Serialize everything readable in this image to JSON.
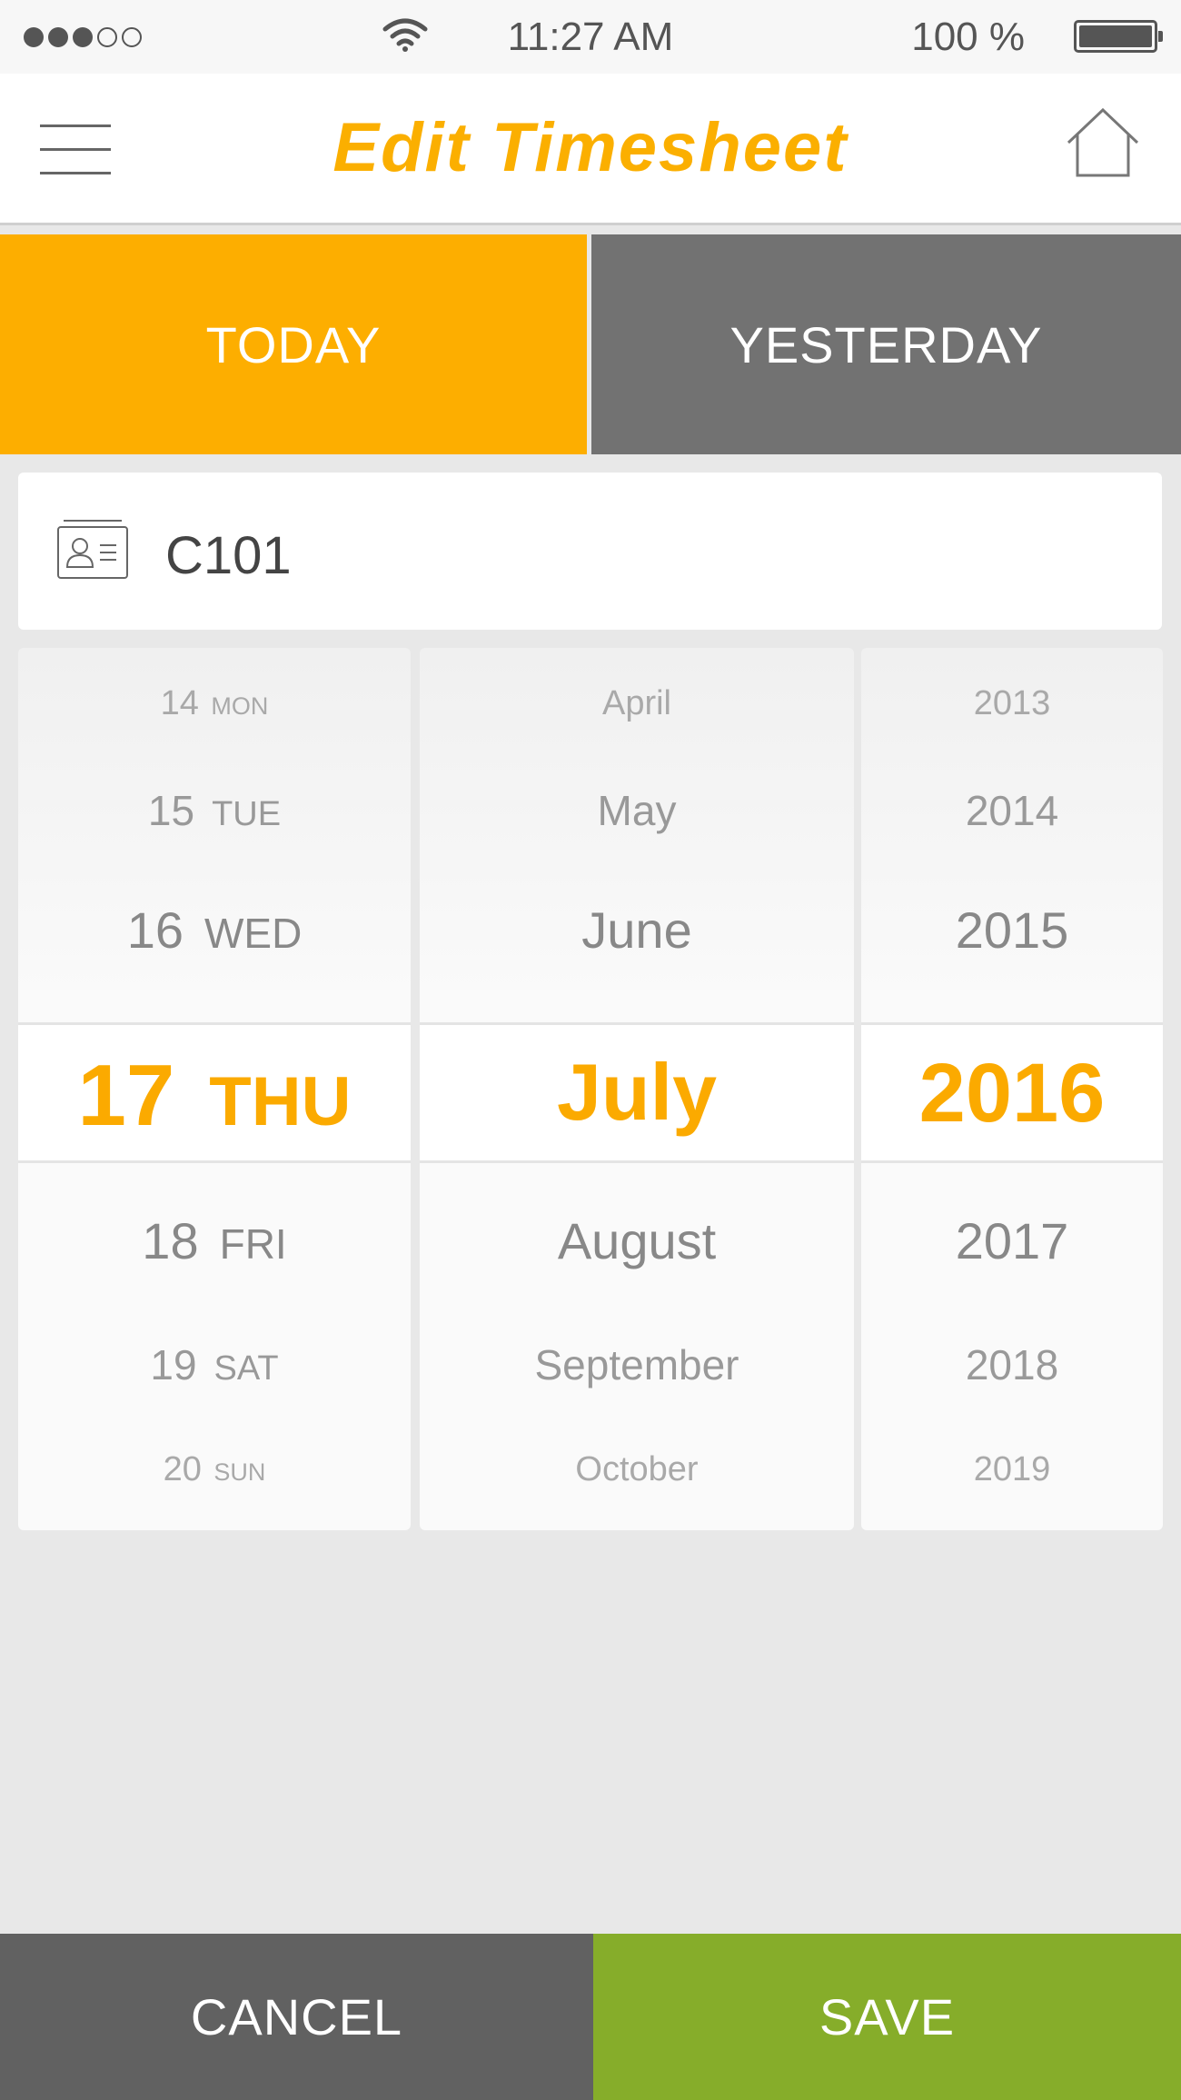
{
  "status_bar": {
    "time": "11:27 AM",
    "battery": "100 %",
    "signal_bars_filled": 3,
    "signal_bars_total": 5
  },
  "header": {
    "title": "Edit Timesheet",
    "left_icon": "hamburger-menu-icon",
    "right_icon": "home-icon"
  },
  "tabs": [
    {
      "label": "TODAY",
      "selected": true
    },
    {
      "label": "YESTERDAY",
      "selected": false
    }
  ],
  "employee": {
    "icon": "id-card-icon",
    "value": "C101"
  },
  "picker": {
    "days": [
      {
        "num": "14",
        "wd": "MON"
      },
      {
        "num": "15",
        "wd": "TUE"
      },
      {
        "num": "16",
        "wd": "WED"
      },
      {
        "num": "17",
        "wd": "THU"
      },
      {
        "num": "18",
        "wd": "FRI"
      },
      {
        "num": "19",
        "wd": "SAT"
      },
      {
        "num": "20",
        "wd": "SUN"
      }
    ],
    "months": [
      "April",
      "May",
      "June",
      "July",
      "August",
      "September",
      "October"
    ],
    "years": [
      "2013",
      "2014",
      "2015",
      "2016",
      "2017",
      "2018",
      "2019"
    ],
    "selected_index": 3
  },
  "footer": {
    "cancel_label": "CANCEL",
    "save_label": "SAVE"
  },
  "colors": {
    "accent": "#fbaf00",
    "tab_inactive": "#727272",
    "cancel": "#616161",
    "save": "#86ad2a",
    "background": "#e8e8e8"
  }
}
